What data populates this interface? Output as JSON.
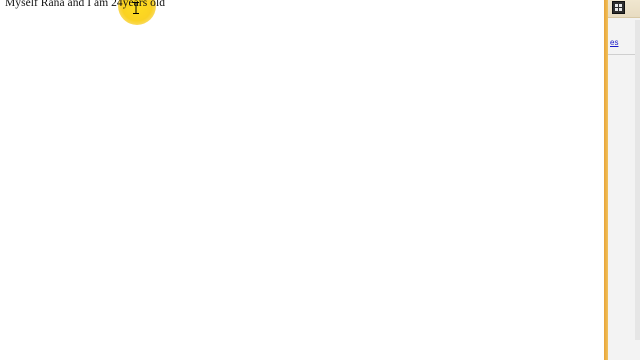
{
  "page": {
    "text": "Myself Rana and I am 24years old"
  },
  "cursor": {
    "highlight_color": "#F9CF16"
  },
  "side_panel": {
    "link_fragment": "es",
    "accent_color": "#EAA93F",
    "link_color": "#1A1AC9",
    "top_button_icon": "grid-icon"
  }
}
